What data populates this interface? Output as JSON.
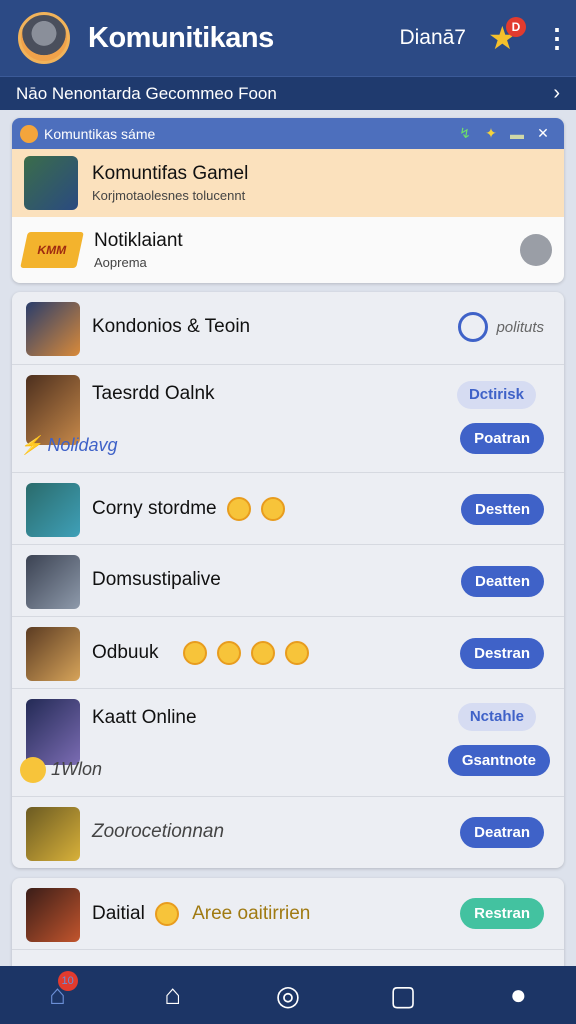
{
  "header": {
    "title": "Komunitikans",
    "link": "Dianā7",
    "badge": "D",
    "menu_icon": "kebab-icon"
  },
  "banner": {
    "text": "Nāo Nenontarda Gecommeo Foon",
    "chevron": "›"
  },
  "notification_card": {
    "header_label": "Komuntikas sáme",
    "icons": [
      "↯",
      "✦",
      "▬",
      "✕"
    ],
    "items": [
      {
        "title": "Komuntifas Gamel",
        "subtitle": "Korjmotaolesnes tolucennt"
      },
      {
        "title": "Notiklaiant",
        "subtitle": "Aoprema",
        "logo_text": "KMM"
      }
    ]
  },
  "list": [
    {
      "title": "Kondonios & Teoin",
      "action": "polituts",
      "thumb": [
        "#2a3d6b",
        "#d98a3a"
      ]
    },
    {
      "title": "Taesrdd Oalnk",
      "sub": "Nolidavg",
      "pill": "Dctirisk",
      "button": "Poatran",
      "thumb": [
        "#4c2f1e",
        "#c7894a"
      ]
    },
    {
      "title": "Corny stordme",
      "button": "Destten",
      "thumb": [
        "#2a6b6b",
        "#3fa0b8"
      ]
    },
    {
      "title": "Domsustipalive",
      "button": "Deatten",
      "thumb": [
        "#3b4252",
        "#8e9aab"
      ]
    },
    {
      "title": "Odbuuk",
      "button": "Destran",
      "thumb": [
        "#5b3b22",
        "#d7a45a"
      ]
    },
    {
      "title": "Kaatt Online",
      "sub": "1Wlon",
      "pill": "Nctahle",
      "button": "Gsantnote",
      "thumb": [
        "#232a55",
        "#7b6cb3"
      ]
    },
    {
      "title": "Zoorocetionnan",
      "button": "Deatran",
      "thumb": [
        "#6b5a22",
        "#d8b13a"
      ]
    }
  ],
  "bottom_item": {
    "title": "Daitial",
    "sub": "Aree oaitirrien",
    "button": "Restran"
  },
  "tabs": [
    {
      "name": "tab-home-badge",
      "glyph": "⌂",
      "badge": "10"
    },
    {
      "name": "tab-home",
      "glyph": "⌂"
    },
    {
      "name": "tab-circle",
      "glyph": "◎"
    },
    {
      "name": "tab-square",
      "glyph": "▢"
    },
    {
      "name": "tab-profile",
      "glyph": "●"
    }
  ],
  "colors": {
    "header": "#2c4a85",
    "accent": "#3f62c8",
    "tabbar": "#1c3566",
    "highlight": "#fbe1bd",
    "success": "#43c2a0"
  }
}
